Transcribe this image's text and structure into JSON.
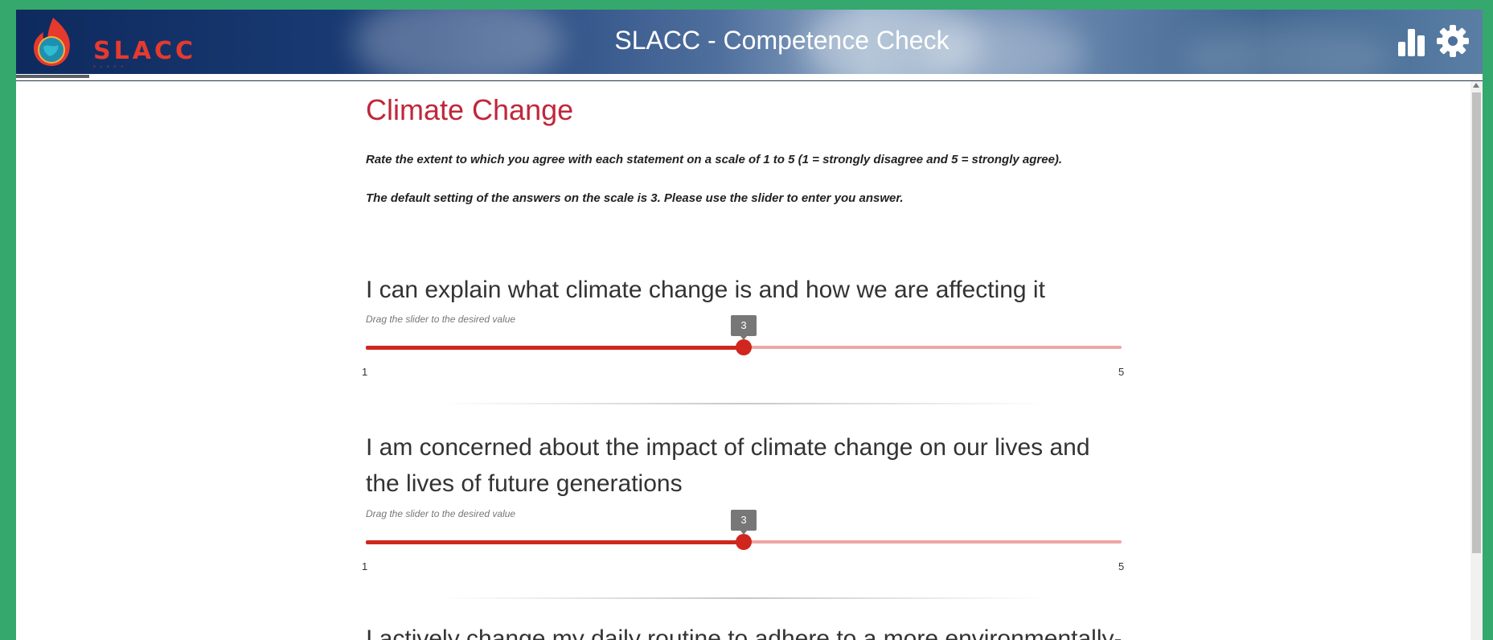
{
  "header": {
    "title": "SLACC - Competence Check",
    "logo_text": "SLACC",
    "logo_sub": "SLACC · · · · ·",
    "icons": [
      "bar-chart-icon",
      "gear-icon"
    ]
  },
  "progress": {
    "value": 0.05
  },
  "page": {
    "title": "Climate Change",
    "instruction1": "Rate the extent to which you agree with each statement on a scale of 1 to 5 (1 = strongly disagree and 5 = strongly agree).",
    "instruction2": "The default setting of the answers on the scale is 3. Please use the slider to enter you answer."
  },
  "questions": [
    {
      "text": "I can explain what climate change is and how we are affecting it",
      "hint": "Drag the slider to the desired value",
      "value": "3",
      "min": "1",
      "max": "5"
    },
    {
      "text": "I am concerned about the impact of climate change on our lives and the lives of future generations",
      "hint": "Drag the slider to the desired value",
      "value": "3",
      "min": "1",
      "max": "5"
    },
    {
      "text": "I actively change my daily routine to adhere to a more environmentally-"
    }
  ],
  "colors": {
    "accent": "#d0261d",
    "title": "#c0273b",
    "page_bg": "#35a86e"
  }
}
